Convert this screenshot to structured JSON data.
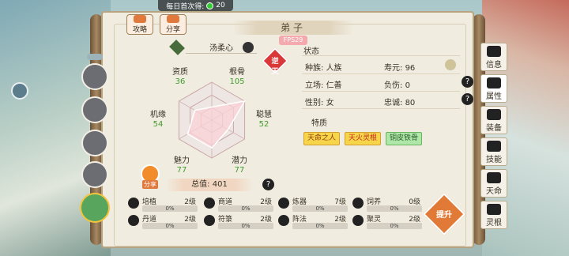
{
  "topbar": {
    "label": "每日首次得:",
    "amount": "20"
  },
  "buttons": {
    "guide": "攻略",
    "share": "分享",
    "radar_share": "分享",
    "upgrade": "提升"
  },
  "title": "弟子",
  "fps": "FPS29",
  "disciple": {
    "name": "汤柔心",
    "badge": "逆天"
  },
  "radar": {
    "stats": [
      {
        "key": "资质",
        "value": "36",
        "amount": 36
      },
      {
        "key": "根骨",
        "value": "105",
        "amount": 105
      },
      {
        "key": "聪慧",
        "value": "52",
        "amount": 52
      },
      {
        "key": "潜力",
        "value": "77",
        "amount": 77
      },
      {
        "key": "魅力",
        "value": "77",
        "amount": 77
      },
      {
        "key": "机缘",
        "value": "54",
        "amount": 54
      }
    ],
    "max": 105,
    "total_label": "总值:",
    "total": "401"
  },
  "status": {
    "title": "状态",
    "rows": [
      {
        "k1": "种族:",
        "v1": "人族",
        "k2": "寿元:",
        "v2": "96"
      },
      {
        "k1": "立场:",
        "v1": "仁善",
        "k2": "负伤:",
        "v2": "0"
      },
      {
        "k1": "性别:",
        "v1": "女",
        "k2": "忠诚:",
        "v2": "80"
      }
    ]
  },
  "traits": {
    "title": "特质",
    "items": [
      "天命之人",
      "天火灵根",
      "铜皮铁骨"
    ]
  },
  "skills": [
    {
      "name": "培植",
      "level": "2级",
      "progress": "0%"
    },
    {
      "name": "商道",
      "level": "2级",
      "progress": "0%"
    },
    {
      "name": "炼器",
      "level": "7级",
      "progress": "0%"
    },
    {
      "name": "饲养",
      "level": "0级",
      "progress": "0%"
    },
    {
      "name": "丹道",
      "level": "2级",
      "progress": "0%"
    },
    {
      "name": "符箓",
      "level": "2级",
      "progress": "0%"
    },
    {
      "name": "阵法",
      "level": "2级",
      "progress": "0%"
    },
    {
      "name": "聚灵",
      "level": "2级",
      "progress": "0%"
    }
  ],
  "tabs": [
    "信息",
    "属性",
    "装备",
    "技能",
    "天命",
    "灵根"
  ]
}
